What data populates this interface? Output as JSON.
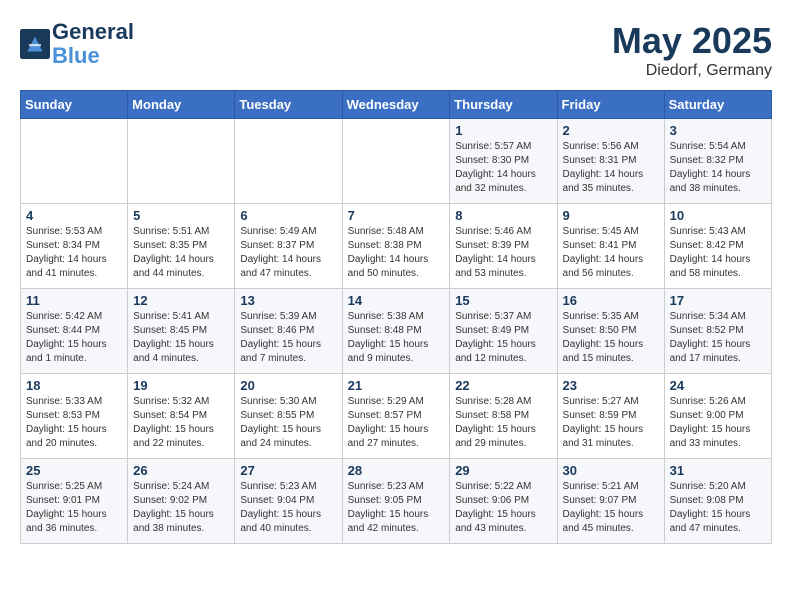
{
  "header": {
    "logo_line1": "General",
    "logo_line2": "Blue",
    "month": "May 2025",
    "location": "Diedorf, Germany"
  },
  "weekdays": [
    "Sunday",
    "Monday",
    "Tuesday",
    "Wednesday",
    "Thursday",
    "Friday",
    "Saturday"
  ],
  "weeks": [
    [
      {
        "day": "",
        "sunrise": "",
        "sunset": "",
        "daylight": ""
      },
      {
        "day": "",
        "sunrise": "",
        "sunset": "",
        "daylight": ""
      },
      {
        "day": "",
        "sunrise": "",
        "sunset": "",
        "daylight": ""
      },
      {
        "day": "",
        "sunrise": "",
        "sunset": "",
        "daylight": ""
      },
      {
        "day": "1",
        "sunrise": "Sunrise: 5:57 AM",
        "sunset": "Sunset: 8:30 PM",
        "daylight": "Daylight: 14 hours and 32 minutes."
      },
      {
        "day": "2",
        "sunrise": "Sunrise: 5:56 AM",
        "sunset": "Sunset: 8:31 PM",
        "daylight": "Daylight: 14 hours and 35 minutes."
      },
      {
        "day": "3",
        "sunrise": "Sunrise: 5:54 AM",
        "sunset": "Sunset: 8:32 PM",
        "daylight": "Daylight: 14 hours and 38 minutes."
      }
    ],
    [
      {
        "day": "4",
        "sunrise": "Sunrise: 5:53 AM",
        "sunset": "Sunset: 8:34 PM",
        "daylight": "Daylight: 14 hours and 41 minutes."
      },
      {
        "day": "5",
        "sunrise": "Sunrise: 5:51 AM",
        "sunset": "Sunset: 8:35 PM",
        "daylight": "Daylight: 14 hours and 44 minutes."
      },
      {
        "day": "6",
        "sunrise": "Sunrise: 5:49 AM",
        "sunset": "Sunset: 8:37 PM",
        "daylight": "Daylight: 14 hours and 47 minutes."
      },
      {
        "day": "7",
        "sunrise": "Sunrise: 5:48 AM",
        "sunset": "Sunset: 8:38 PM",
        "daylight": "Daylight: 14 hours and 50 minutes."
      },
      {
        "day": "8",
        "sunrise": "Sunrise: 5:46 AM",
        "sunset": "Sunset: 8:39 PM",
        "daylight": "Daylight: 14 hours and 53 minutes."
      },
      {
        "day": "9",
        "sunrise": "Sunrise: 5:45 AM",
        "sunset": "Sunset: 8:41 PM",
        "daylight": "Daylight: 14 hours and 56 minutes."
      },
      {
        "day": "10",
        "sunrise": "Sunrise: 5:43 AM",
        "sunset": "Sunset: 8:42 PM",
        "daylight": "Daylight: 14 hours and 58 minutes."
      }
    ],
    [
      {
        "day": "11",
        "sunrise": "Sunrise: 5:42 AM",
        "sunset": "Sunset: 8:44 PM",
        "daylight": "Daylight: 15 hours and 1 minute."
      },
      {
        "day": "12",
        "sunrise": "Sunrise: 5:41 AM",
        "sunset": "Sunset: 8:45 PM",
        "daylight": "Daylight: 15 hours and 4 minutes."
      },
      {
        "day": "13",
        "sunrise": "Sunrise: 5:39 AM",
        "sunset": "Sunset: 8:46 PM",
        "daylight": "Daylight: 15 hours and 7 minutes."
      },
      {
        "day": "14",
        "sunrise": "Sunrise: 5:38 AM",
        "sunset": "Sunset: 8:48 PM",
        "daylight": "Daylight: 15 hours and 9 minutes."
      },
      {
        "day": "15",
        "sunrise": "Sunrise: 5:37 AM",
        "sunset": "Sunset: 8:49 PM",
        "daylight": "Daylight: 15 hours and 12 minutes."
      },
      {
        "day": "16",
        "sunrise": "Sunrise: 5:35 AM",
        "sunset": "Sunset: 8:50 PM",
        "daylight": "Daylight: 15 hours and 15 minutes."
      },
      {
        "day": "17",
        "sunrise": "Sunrise: 5:34 AM",
        "sunset": "Sunset: 8:52 PM",
        "daylight": "Daylight: 15 hours and 17 minutes."
      }
    ],
    [
      {
        "day": "18",
        "sunrise": "Sunrise: 5:33 AM",
        "sunset": "Sunset: 8:53 PM",
        "daylight": "Daylight: 15 hours and 20 minutes."
      },
      {
        "day": "19",
        "sunrise": "Sunrise: 5:32 AM",
        "sunset": "Sunset: 8:54 PM",
        "daylight": "Daylight: 15 hours and 22 minutes."
      },
      {
        "day": "20",
        "sunrise": "Sunrise: 5:30 AM",
        "sunset": "Sunset: 8:55 PM",
        "daylight": "Daylight: 15 hours and 24 minutes."
      },
      {
        "day": "21",
        "sunrise": "Sunrise: 5:29 AM",
        "sunset": "Sunset: 8:57 PM",
        "daylight": "Daylight: 15 hours and 27 minutes."
      },
      {
        "day": "22",
        "sunrise": "Sunrise: 5:28 AM",
        "sunset": "Sunset: 8:58 PM",
        "daylight": "Daylight: 15 hours and 29 minutes."
      },
      {
        "day": "23",
        "sunrise": "Sunrise: 5:27 AM",
        "sunset": "Sunset: 8:59 PM",
        "daylight": "Daylight: 15 hours and 31 minutes."
      },
      {
        "day": "24",
        "sunrise": "Sunrise: 5:26 AM",
        "sunset": "Sunset: 9:00 PM",
        "daylight": "Daylight: 15 hours and 33 minutes."
      }
    ],
    [
      {
        "day": "25",
        "sunrise": "Sunrise: 5:25 AM",
        "sunset": "Sunset: 9:01 PM",
        "daylight": "Daylight: 15 hours and 36 minutes."
      },
      {
        "day": "26",
        "sunrise": "Sunrise: 5:24 AM",
        "sunset": "Sunset: 9:02 PM",
        "daylight": "Daylight: 15 hours and 38 minutes."
      },
      {
        "day": "27",
        "sunrise": "Sunrise: 5:23 AM",
        "sunset": "Sunset: 9:04 PM",
        "daylight": "Daylight: 15 hours and 40 minutes."
      },
      {
        "day": "28",
        "sunrise": "Sunrise: 5:23 AM",
        "sunset": "Sunset: 9:05 PM",
        "daylight": "Daylight: 15 hours and 42 minutes."
      },
      {
        "day": "29",
        "sunrise": "Sunrise: 5:22 AM",
        "sunset": "Sunset: 9:06 PM",
        "daylight": "Daylight: 15 hours and 43 minutes."
      },
      {
        "day": "30",
        "sunrise": "Sunrise: 5:21 AM",
        "sunset": "Sunset: 9:07 PM",
        "daylight": "Daylight: 15 hours and 45 minutes."
      },
      {
        "day": "31",
        "sunrise": "Sunrise: 5:20 AM",
        "sunset": "Sunset: 9:08 PM",
        "daylight": "Daylight: 15 hours and 47 minutes."
      }
    ]
  ]
}
